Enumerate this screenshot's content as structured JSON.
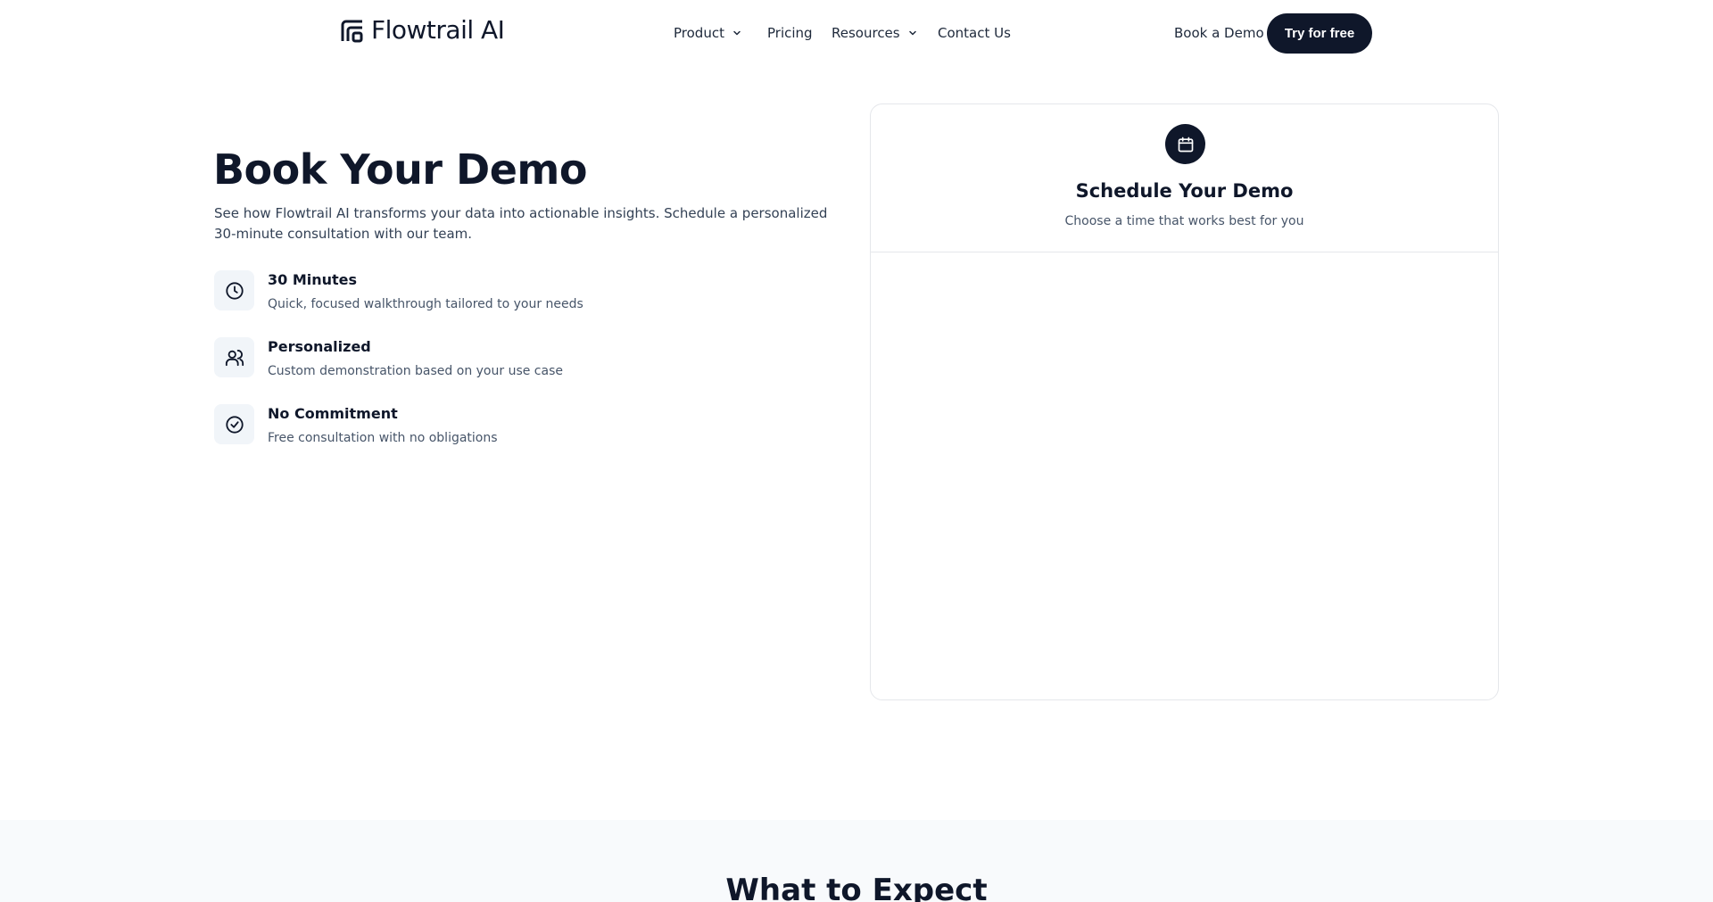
{
  "header": {
    "brand": "Flowtrail AI",
    "nav": [
      {
        "label": "Product",
        "has_dropdown": true
      },
      {
        "label": "Pricing",
        "has_dropdown": false
      },
      {
        "label": "Resources",
        "has_dropdown": true
      },
      {
        "label": "Contact Us",
        "has_dropdown": false
      }
    ],
    "book_demo_label": "Book a Demo",
    "try_free_label": "Try for free"
  },
  "hero": {
    "title": "Book Your Demo",
    "description": "See how Flowtrail AI transforms your data into actionable insights. Schedule a personalized 30-minute consultation with our team.",
    "features": [
      {
        "icon": "clock-icon",
        "title": "30 Minutes",
        "description": "Quick, focused walkthrough tailored to your needs"
      },
      {
        "icon": "users-icon",
        "title": "Personalized",
        "description": "Custom demonstration based on your use case"
      },
      {
        "icon": "check-circle-icon",
        "title": "No Commitment",
        "description": "Free consultation with no obligations"
      }
    ]
  },
  "schedule_card": {
    "icon": "calendar-icon",
    "title": "Schedule Your Demo",
    "subtitle": "Choose a time that works best for you"
  },
  "expect_section": {
    "title": "What to Expect"
  },
  "colors": {
    "primary": "#0f172a",
    "muted_text": "#475569",
    "icon_bg": "#f1f5f9",
    "border": "#e5e7eb",
    "section_bg": "#f8fafc"
  }
}
